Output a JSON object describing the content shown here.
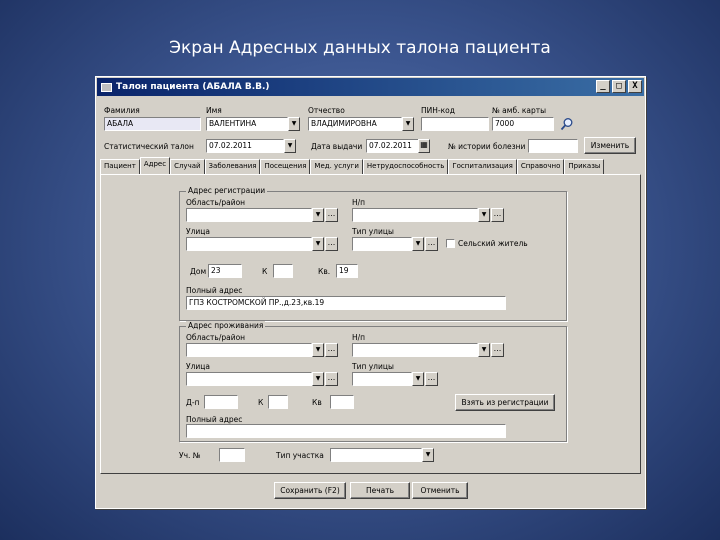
{
  "slide_title": "Экран Адресных данных талона пациента",
  "window": {
    "title": "Талон пациента (АБАЛА В.В.)",
    "buttons": {
      "minimize": "_",
      "maximize": "□",
      "close": "X"
    }
  },
  "header": {
    "surname_label": "Фамилия",
    "surname_value": "АБАЛА",
    "name_label": "Имя",
    "name_value": "ВАЛЕНТИНА",
    "patronymic_label": "Отчество",
    "patronymic_value": "ВЛАДИМИРОВНА",
    "pin_label": "ПИН-код",
    "pin_value": "",
    "card_label": "№ амб. карты",
    "card_value": "7000",
    "stat_label": "Статистический талон",
    "stat_value": "07.02.2011",
    "issue_date_label": "Дата выдачи",
    "issue_date_value": "07.02.2011",
    "case_history_label": "№ истории болезни",
    "case_history_value": "",
    "refresh_button": "Изменить"
  },
  "tabs": [
    "Пациент",
    "Адрес",
    "Случай",
    "Заболевания",
    "Посещения",
    "Мед. услуги",
    "Нетрудоспособность",
    "Госпитализация",
    "Справочно",
    "Приказы"
  ],
  "active_tab": "Адрес",
  "registration": {
    "group_title": "Адрес регистрации",
    "region_label": "Область/район",
    "region_value": "",
    "np_label": "Н/п",
    "np_value": "",
    "street_label": "Улица",
    "street_value": "",
    "street_type_label": "Тип улицы",
    "street_type_value": "",
    "rural_label": "Сельский житель",
    "house_label": "Дом",
    "house_value": "23",
    "korpus_label": "К",
    "korpus_value": "",
    "apt_label": "Кв.",
    "apt_value": "19",
    "full_label": "Полный адрес",
    "full_value": "ГПЗ КОСТРОМСКОЙ ПР.,д.23,кв.19"
  },
  "residence": {
    "group_title": "Адрес проживания",
    "region_label": "Область/район",
    "region_value": "",
    "np_label": "Н/п",
    "np_value": "",
    "street_label": "Улица",
    "street_value": "",
    "street_type_label": "Тип улицы",
    "street_type_value": "",
    "house_label": "Д-п",
    "house_value": "",
    "korpus_label": "К",
    "korpus_value": "",
    "apt_label": "Кв",
    "apt_value": "",
    "copy_button": "Взять из регистрации",
    "full_label": "Полный адрес",
    "full_value": ""
  },
  "district": {
    "num_label": "Уч. №",
    "num_value": "",
    "type_label": "Тип участка",
    "type_value": ""
  },
  "footer": {
    "save": "Сохранить (F2)",
    "print": "Печать",
    "cancel": "Отменить"
  }
}
